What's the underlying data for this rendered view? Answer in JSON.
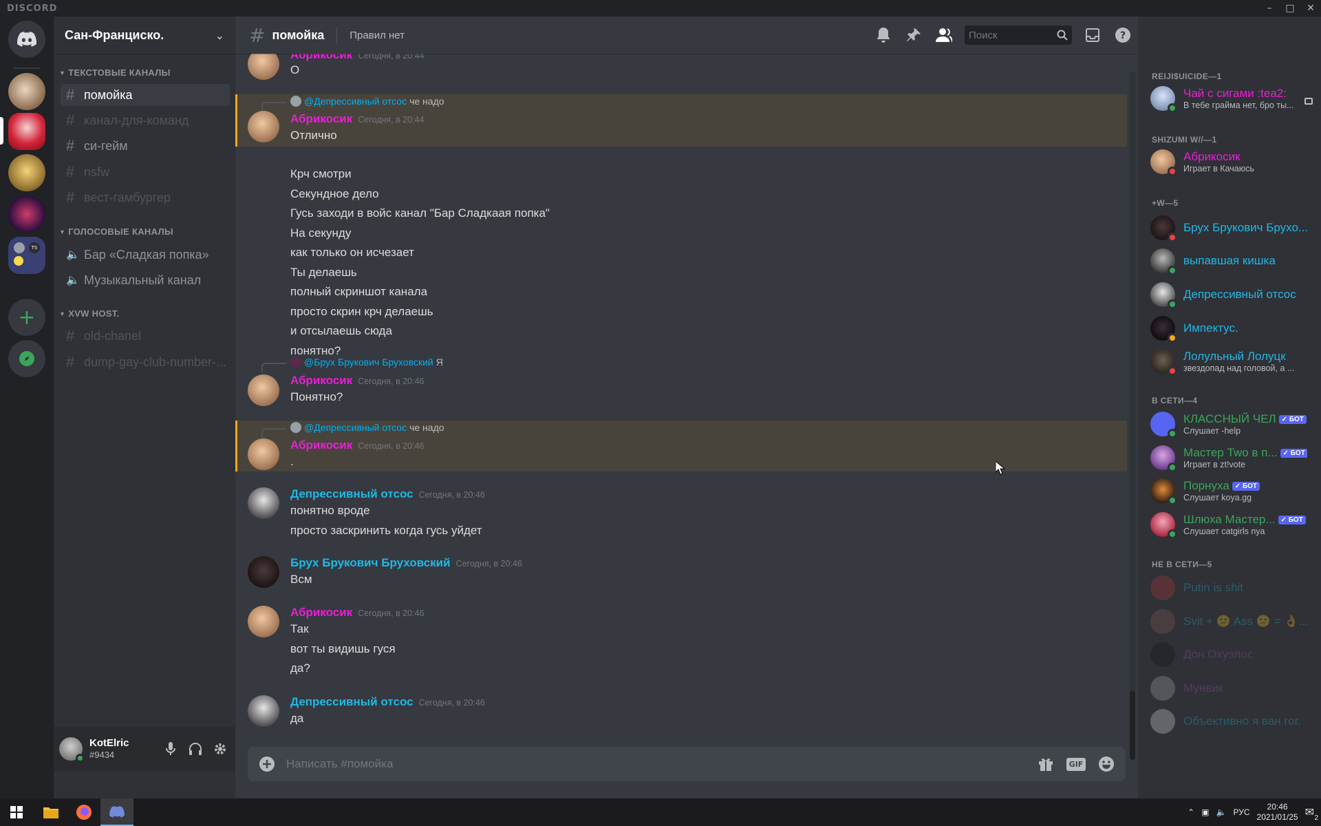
{
  "app": {
    "brand": "DISCORD"
  },
  "server": {
    "name": "Сан-Франциско."
  },
  "categories": {
    "text": "ТЕКСТОВЫЕ КАНАЛЫ",
    "voice": "ГОЛОСОВЫЕ КАНАЛЫ",
    "xvw": "XVW HOST."
  },
  "channels": {
    "text": [
      "помойка",
      "канал-для-команд",
      "си-гейм",
      "nsfw",
      "вест-гамбургер"
    ],
    "voice": [
      "Бар «Сладкая попка»",
      "Музыкальный канал"
    ],
    "xvw": [
      "old-chanel",
      "dump-gay-club-number-..."
    ]
  },
  "user": {
    "name": "KotElric",
    "tag": "#9434"
  },
  "header": {
    "channel": "помойка",
    "topic": "Правил нет",
    "search_placeholder": "Поиск"
  },
  "messages": [
    {
      "author": "Абрикосик",
      "time": "Сегодня, в 20:44",
      "lines": [
        "О"
      ]
    },
    {
      "reply_mention": "@Депрессивный отсос",
      "reply_text": "че надо",
      "author": "Абрикосик",
      "time": "Сегодня, в 20:44",
      "lines": [
        "Отлично",
        "Крч смотри",
        "Секундное дело",
        "Гусь заходи в войс канал \"Бар Сладкаая попка\"",
        "На секунду",
        "как только он исчезает",
        "Ты делаешь",
        "полный скриншот канала",
        "просто скрин крч делаешь",
        "и отсылаешь сюда",
        "понятно?"
      ]
    },
    {
      "reply_mention": "@Брух Брукович Бруховский",
      "reply_text": "Я",
      "author": "Абрикосик",
      "time": "Сегодня, в 20:46",
      "lines": [
        "Понятно?"
      ]
    },
    {
      "reply_mention": "@Депрессивный отсос",
      "reply_text": "че надо",
      "author": "Абрикосик",
      "time": "Сегодня, в 20:46",
      "lines": [
        "."
      ]
    },
    {
      "author": "Депрессивный отсос",
      "time": "Сегодня, в 20:46",
      "lines": [
        "понятно вроде",
        "просто заскринить когда гусь уйдет"
      ]
    },
    {
      "author": "Брух Брукович Бруховский",
      "time": "Сегодня, в 20:46",
      "lines": [
        "Всм"
      ]
    },
    {
      "author": "Абрикосик",
      "time": "Сегодня, в 20:46",
      "lines": [
        "Так",
        "вот ты видишь гуся",
        "да?"
      ]
    },
    {
      "author": "Депрессивный отсос",
      "time": "Сегодня, в 20:46",
      "lines": [
        "да"
      ]
    }
  ],
  "composer": {
    "placeholder": "Написать #помойка"
  },
  "member_groups": {
    "g1": "REIJI$UICIDE—1",
    "g2": "SHIZUMI W//—1",
    "g3": "+W—5",
    "g4": "В СЕТИ—4",
    "g5": "НЕ В СЕТИ—5"
  },
  "members": [
    {
      "name": "Чай с сигами :tea2:",
      "status": "В тебе грайма нет, бро ты..."
    },
    {
      "name": "Абрикосик",
      "status": "Играет в Качаюсь"
    },
    {
      "name": "Брух Брукович Брухо...",
      "status": ""
    },
    {
      "name": "выпавшая кишка",
      "status": ""
    },
    {
      "name": "Депрессивный отсос",
      "status": ""
    },
    {
      "name": "Импектус.",
      "status": ""
    },
    {
      "name": "Лолульный Лолуцк",
      "status": "звездопад над головой, а ..."
    },
    {
      "name": "КЛАССНЫЙ ЧЕЛ",
      "status": "Слушает -help",
      "badge": "✓ БОТ"
    },
    {
      "name": "Мастер Two в п...",
      "status": "Играет в zt!vote",
      "badge": "✓ БОТ"
    },
    {
      "name": "Порнуха",
      "status": "Слушает koya.gg",
      "badge": "✓ БОТ"
    },
    {
      "name": "Шлюха Мастер...",
      "status": "Слушает catgirls nya",
      "badge": "✓ БОТ"
    },
    {
      "name": "Putin is shit",
      "status": ""
    },
    {
      "name": "Svit + 😕 Ass 😕 = 👌...",
      "status": ""
    },
    {
      "name": "Дон Охуэлос",
      "status": ""
    },
    {
      "name": "Мунвик",
      "status": ""
    },
    {
      "name": "Объективно я ван гог.",
      "status": ""
    }
  ],
  "taskbar": {
    "lang": "РУС",
    "time": "20:46",
    "date": "2021/01/25",
    "notif_count": "2"
  },
  "colors": {
    "accent": "#5865f2",
    "pink": "#e91ed6",
    "blue": "#1fb8e6",
    "green": "#3ba55c",
    "online": "#3ba55c",
    "dnd": "#ed4245",
    "idle": "#faa81a"
  }
}
